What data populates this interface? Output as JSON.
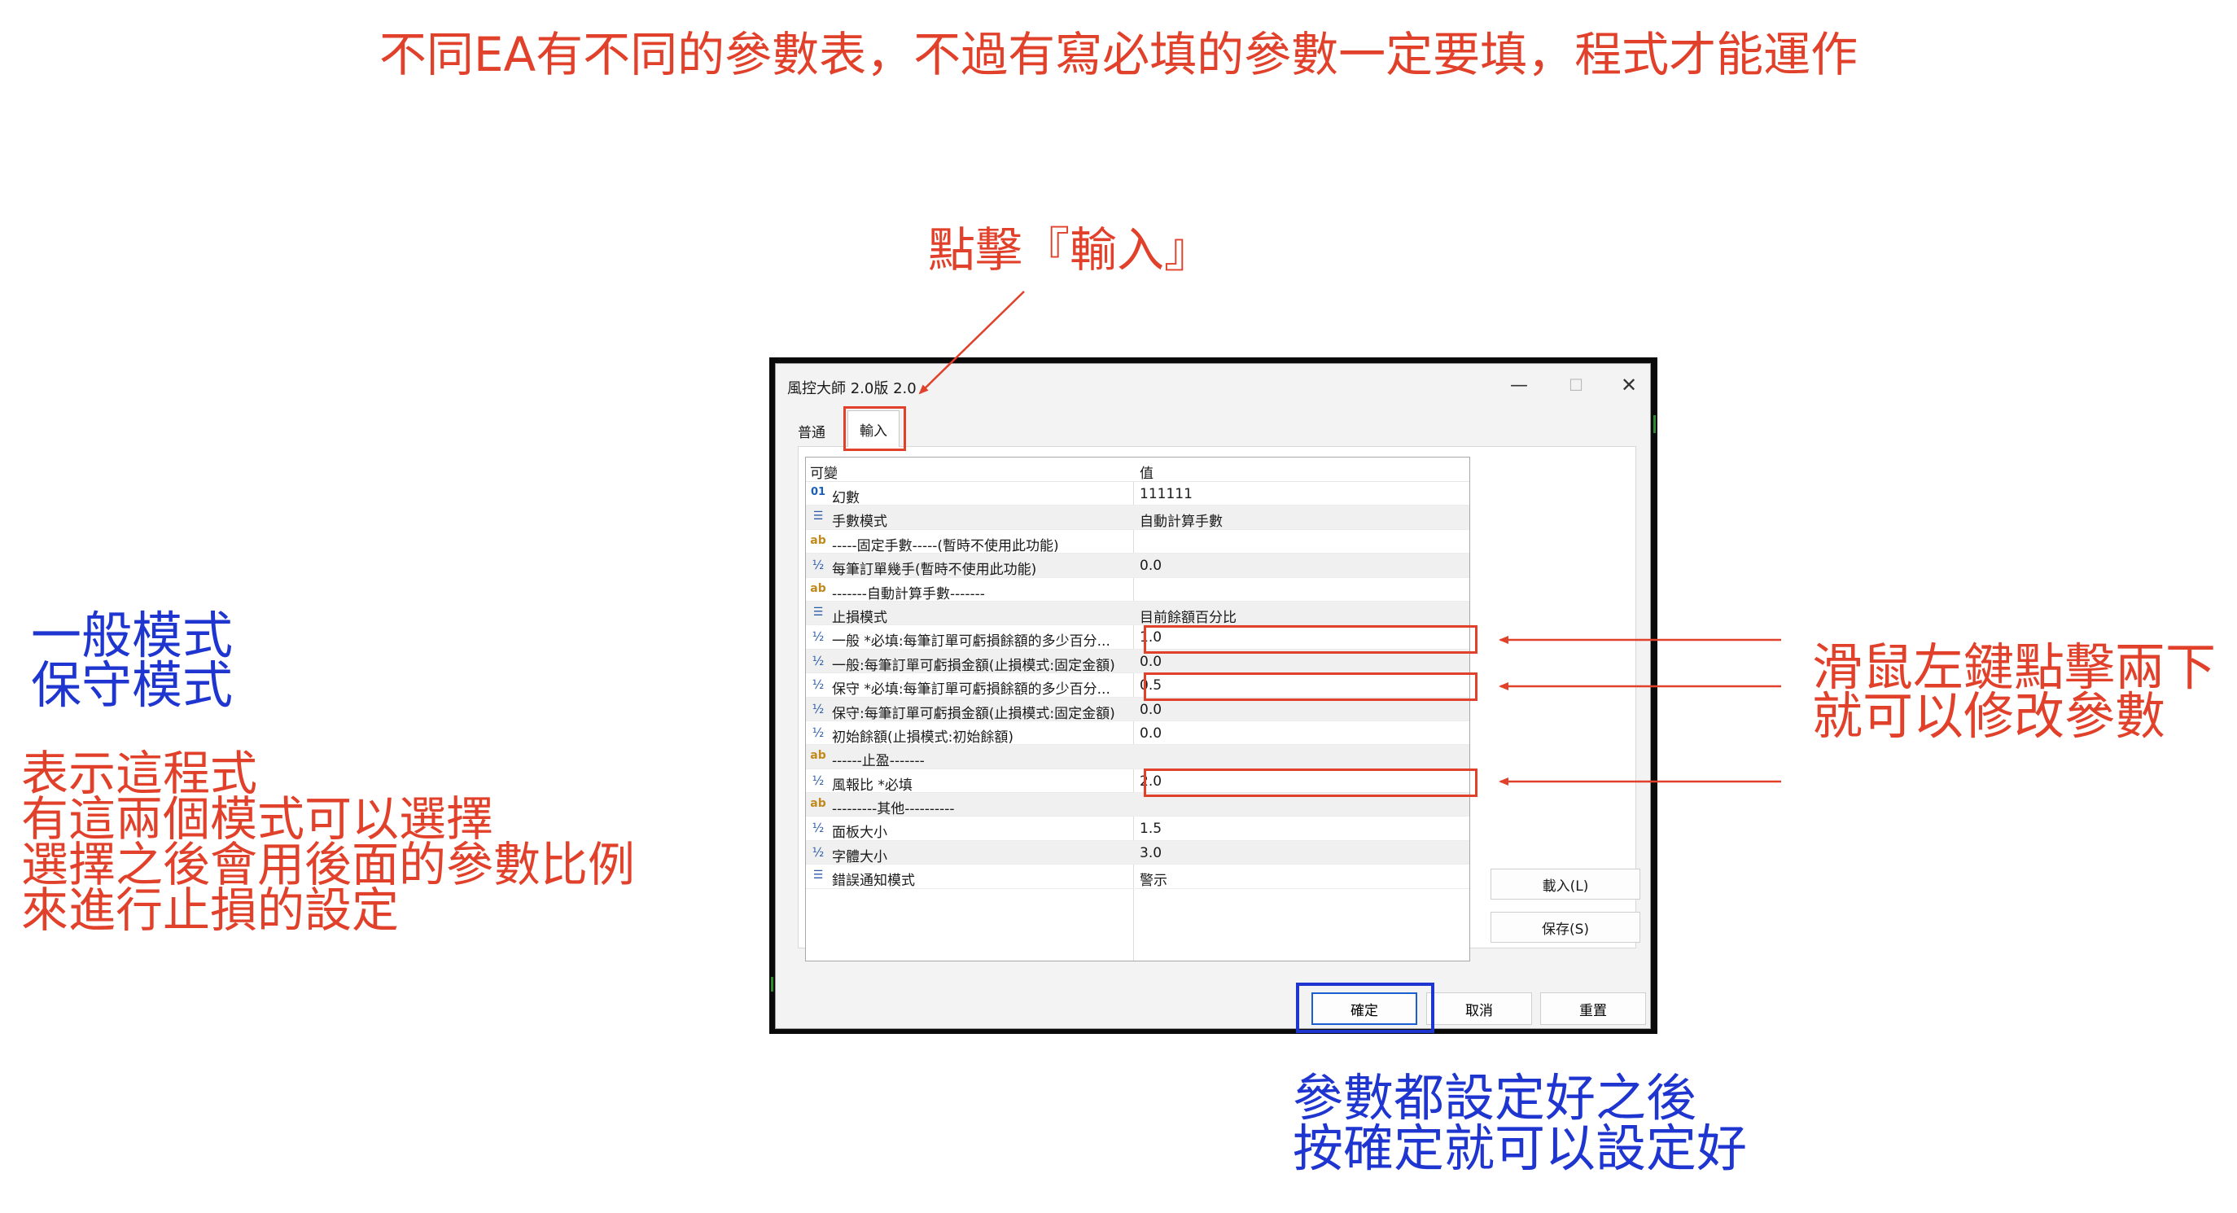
{
  "annotations": {
    "top_title": "不同EA有不同的參數表，不過有寫必填的參數一定要填，程式才能運作",
    "click_input": "點擊『輸入』",
    "mode_note": [
      "一般模式",
      "保守模式"
    ],
    "mode_desc": [
      "表示這程式",
      "有這兩個模式可以選擇",
      "選擇之後會用後面的參數比例",
      "來進行止損的設定"
    ],
    "double_click": [
      "滑鼠左鍵點擊兩下",
      "就可以修改參數"
    ],
    "after_set": [
      "參數都設定好之後",
      "按確定就可以設定好"
    ]
  },
  "dialog": {
    "title": "風控大師 2.0版 2.0",
    "window_controls": {
      "minimize": "—",
      "maximize": "☐",
      "close": "✕"
    },
    "tabs": [
      "普通",
      "輸入"
    ],
    "active_tab": "輸入",
    "columns": {
      "variable": "可變",
      "value": "值"
    },
    "rows": [
      {
        "icon": "int-icon",
        "glyph": "01",
        "name": "幻數",
        "value": "111111"
      },
      {
        "icon": "enum-icon",
        "glyph": "☰",
        "name": "手數模式",
        "value": "自動計算手數"
      },
      {
        "icon": "string-icon",
        "glyph": "ab",
        "name": "-----固定手數-----(暫時不使用此功能)",
        "value": ""
      },
      {
        "icon": "double-icon",
        "glyph": "½",
        "name": "每筆訂單幾手(暫時不使用此功能)",
        "value": "0.0"
      },
      {
        "icon": "string-icon",
        "glyph": "ab",
        "name": "-------自動計算手數-------",
        "value": ""
      },
      {
        "icon": "enum-icon",
        "glyph": "☰",
        "name": "止損模式",
        "value": "目前餘額百分比"
      },
      {
        "icon": "double-icon",
        "glyph": "½",
        "name": "一般 *必填:每筆訂單可虧損餘額的多少百分...",
        "value": "1.0"
      },
      {
        "icon": "double-icon",
        "glyph": "½",
        "name": "一般:每筆訂單可虧損金額(止損模式:固定金額)",
        "value": "0.0"
      },
      {
        "icon": "double-icon",
        "glyph": "½",
        "name": "保守 *必填:每筆訂單可虧損餘額的多少百分...",
        "value": "0.5"
      },
      {
        "icon": "double-icon",
        "glyph": "½",
        "name": "保守:每筆訂單可虧損金額(止損模式:固定金額)",
        "value": "0.0"
      },
      {
        "icon": "double-icon",
        "glyph": "½",
        "name": "初始餘額(止損模式:初始餘額)",
        "value": "0.0"
      },
      {
        "icon": "string-icon",
        "glyph": "ab",
        "name": "------止盈-------",
        "value": ""
      },
      {
        "icon": "double-icon",
        "glyph": "½",
        "name": "風報比 *必填",
        "value": "2.0"
      },
      {
        "icon": "string-icon",
        "glyph": "ab",
        "name": "---------其他----------",
        "value": ""
      },
      {
        "icon": "double-icon",
        "glyph": "½",
        "name": "面板大小",
        "value": "1.5"
      },
      {
        "icon": "double-icon",
        "glyph": "½",
        "name": "字體大小",
        "value": "3.0"
      },
      {
        "icon": "enum-icon",
        "glyph": "☰",
        "name": "錯誤通知模式",
        "value": "警示"
      }
    ],
    "load_button": "載入(L)",
    "save_button": "保存(S)",
    "ok_button": "確定",
    "cancel_button": "取消",
    "reset_button": "重置"
  },
  "colors": {
    "annotation_red": "#e1402a",
    "annotation_blue": "#1f35d0",
    "highlight_red": "#e1402a",
    "highlight_blue": "#1f35d0"
  }
}
